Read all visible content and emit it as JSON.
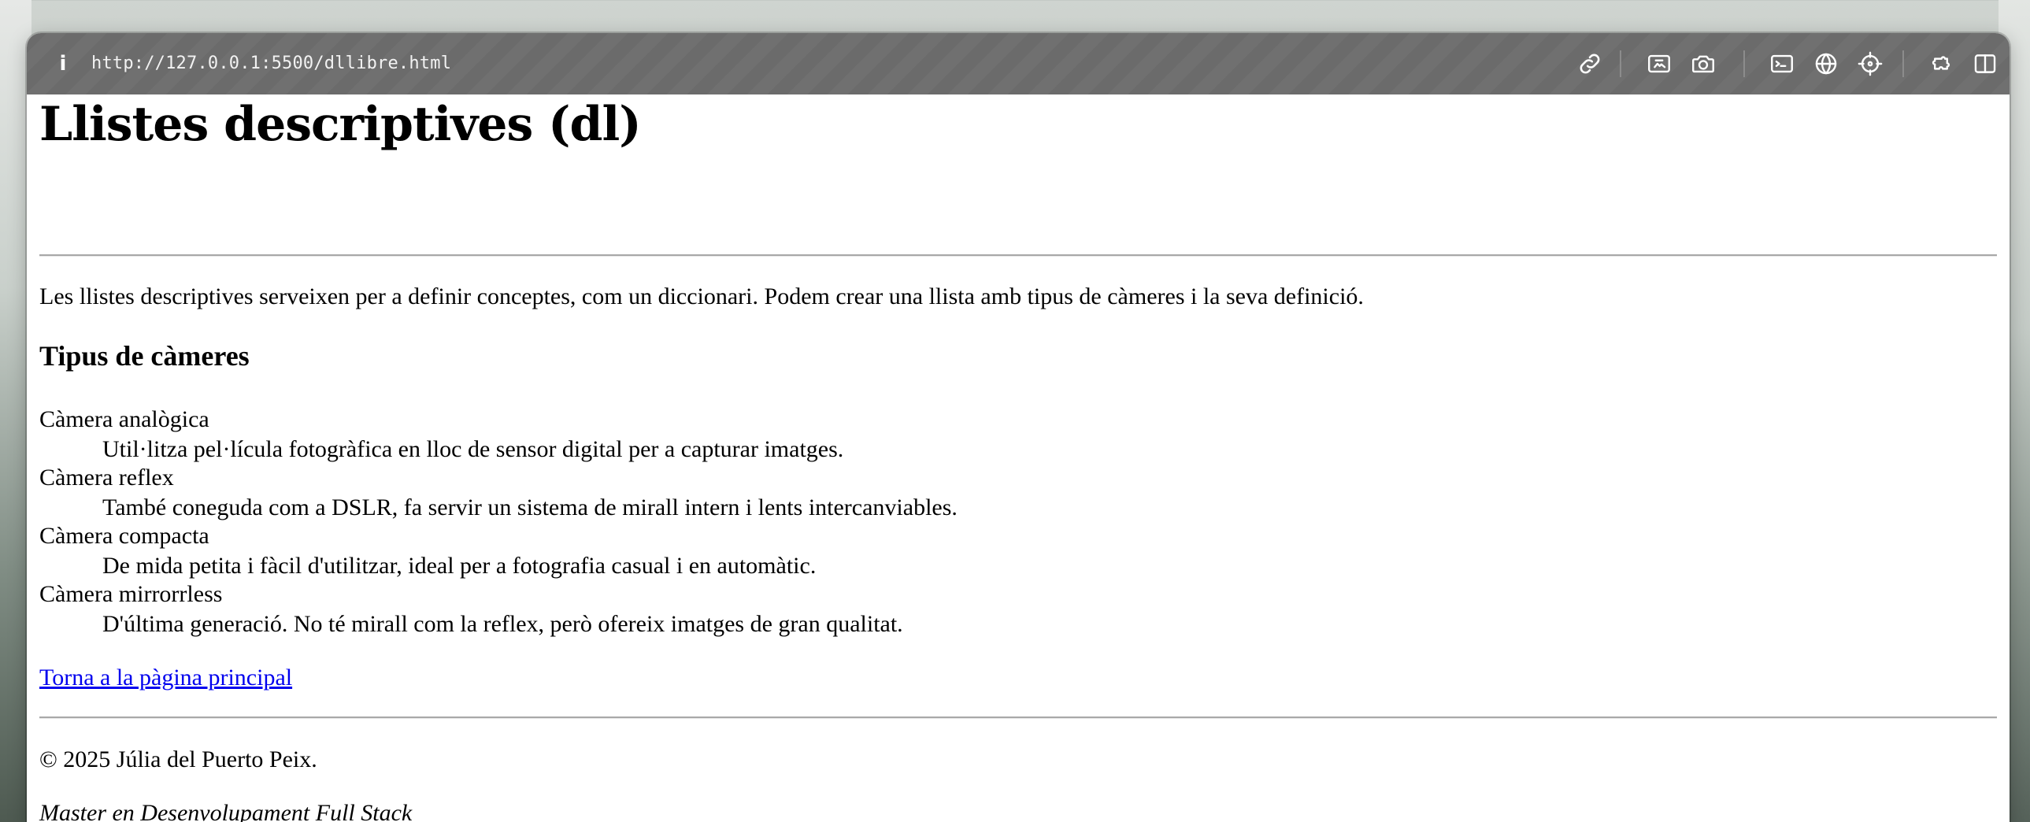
{
  "browser": {
    "url": "http://127.0.0.1:5500/dllibre.html",
    "info_glyph": "i"
  },
  "page": {
    "title": "Llistes descriptives (dl)",
    "intro": "Les llistes descriptives serveixen per a definir conceptes, com un diccionari. Podem crear una llista amb tipus de càmeres i la seva definició.",
    "section_heading": "Tipus de càmeres",
    "definitions": [
      {
        "term": "Càmera analògica",
        "description": "Util·litza pel·lícula fotogràfica en lloc de sensor digital per a capturar imatges."
      },
      {
        "term": "Càmera reflex",
        "description": "També coneguda com a DSLR, fa servir un sistema de mirall intern i lents intercanviables."
      },
      {
        "term": "Càmera compacta",
        "description": "De mida petita i fàcil d'utilitzar, ideal per a fotografia casual i en automàtic."
      },
      {
        "term": "Càmera mirrorrless",
        "description": "D'última generació. No té mirall com la reflex, però ofereix imatges de gran qualitat."
      }
    ],
    "back_link": "Torna a la pàgina principal",
    "footer_copyright": "© 2025 Júlia del Puerto Peix.",
    "footer_course": "Master en Desenvolupament Full Stack"
  },
  "toolbar_icons": [
    "link-icon",
    "screenshot-region-icon",
    "camera-icon",
    "terminal-icon",
    "globe-icon",
    "crosshair-icon",
    "extensions-icon",
    "sidebar-icon"
  ],
  "colors": {
    "toolbar_bg": "#6b6b6b",
    "link": "#0000ee",
    "text": "#000000"
  }
}
